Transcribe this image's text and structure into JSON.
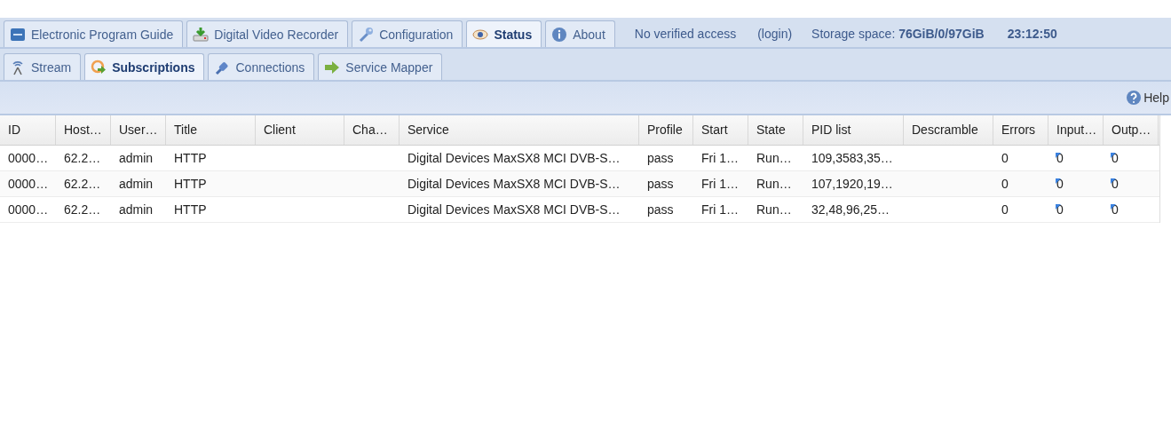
{
  "main_tabs": [
    {
      "label": "Electronic Program Guide",
      "kind": "epg",
      "selected": false
    },
    {
      "label": "Digital Video Recorder",
      "kind": "dvr",
      "selected": false
    },
    {
      "label": "Configuration",
      "kind": "wrench",
      "selected": false
    },
    {
      "label": "Status",
      "kind": "eye",
      "selected": true
    },
    {
      "label": "About",
      "kind": "info",
      "selected": false
    }
  ],
  "header_info": {
    "access": "No verified access",
    "login": "(login)",
    "storage_label": "Storage space:",
    "storage_value": "76GiB/0/97GiB",
    "time": "23:12:50"
  },
  "sub_tabs": [
    {
      "label": "Stream",
      "kind": "antenna",
      "selected": false
    },
    {
      "label": "Subscriptions",
      "kind": "subs",
      "selected": true
    },
    {
      "label": "Connections",
      "kind": "plug",
      "selected": false
    },
    {
      "label": "Service Mapper",
      "kind": "arrow",
      "selected": false
    }
  ],
  "toolbar": {
    "help": "Help"
  },
  "table": {
    "columns": [
      "ID",
      "Host…",
      "User…",
      "Title",
      "Client",
      "Cha…",
      "Service",
      "Profile",
      "Start",
      "State",
      "PID list",
      "Descramble",
      "Errors",
      "Input…",
      "Outp…"
    ],
    "rows": [
      {
        "cells": [
          "0000…",
          "62.2…",
          "admin",
          "HTTP",
          "",
          "",
          "Digital Devices MaxSX8 MCI DVB-S…",
          "pass",
          "Fri 1…",
          "Run…",
          "109,3583,35…",
          "",
          "0"
        ],
        "input": {
          "value": "0",
          "modified": true
        },
        "output": {
          "value": "0",
          "modified": true
        }
      },
      {
        "cells": [
          "0000…",
          "62.2…",
          "admin",
          "HTTP",
          "",
          "",
          "Digital Devices MaxSX8 MCI DVB-S…",
          "pass",
          "Fri 1…",
          "Run…",
          "107,1920,19…",
          "",
          "0"
        ],
        "input": {
          "value": "0",
          "modified": true
        },
        "output": {
          "value": "0",
          "modified": true
        }
      },
      {
        "cells": [
          "0000…",
          "62.2…",
          "admin",
          "HTTP",
          "",
          "",
          "Digital Devices MaxSX8 MCI DVB-S…",
          "pass",
          "Fri 1…",
          "Run…",
          "32,48,96,25…",
          "",
          "0"
        ],
        "input": {
          "value": "0",
          "modified": true
        },
        "output": {
          "value": "0",
          "modified": true
        }
      }
    ]
  }
}
